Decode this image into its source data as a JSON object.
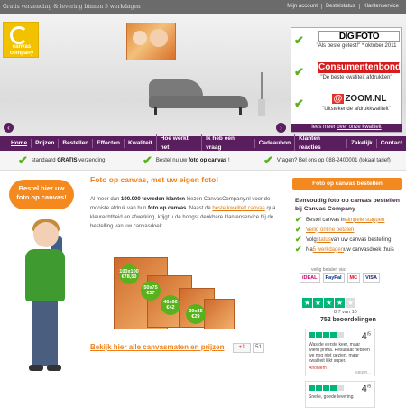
{
  "topbar": {
    "shipping": "Gratis verzending & levering binnen 5 werkdagen",
    "links": [
      "Mijn account",
      "Bestelstatus",
      "Klantenservice"
    ]
  },
  "logo": {
    "line1": "canvas",
    "line2": "company"
  },
  "hero": {
    "prev": "‹",
    "next": "›"
  },
  "reviews": [
    {
      "brand": "DIGIFOTO",
      "quote": "\"Als beste getest!\" * oktober 2011"
    },
    {
      "brand": "Consumentenbond",
      "quote": "\"De beste kwaliteit afdrukken\""
    },
    {
      "brand_prefix": "@",
      "brand": "ZOOM.NL",
      "quote": "\"Uitstekende afdrukkwaliteit\""
    }
  ],
  "lees": {
    "prefix": "lees meer",
    "link": "over onze kwaliteit"
  },
  "nav": [
    "Home",
    "Prijzen",
    "Bestellen",
    "Effecten",
    "Kwaliteit",
    "Hoe werkt het",
    "Ik heb een vraag",
    "Cadeaubon",
    "Klanten reacties",
    "Zakelijk",
    "Contact"
  ],
  "usps": [
    {
      "pre": "standaard ",
      "bold": "GRATIS",
      "post": " verzending"
    },
    {
      "pre": "Bestel nu uw ",
      "bold": "foto op canvas",
      "post": " !"
    },
    {
      "pre": "Vragen? Bel ons op 088-2400001 (lokaal tarief)",
      "bold": "",
      "post": ""
    }
  ],
  "badge": {
    "line1": "Bestel hier uw",
    "line2": "foto op canvas!"
  },
  "main": {
    "title": "Foto op canvas, met uw eigen foto!",
    "p1a": "Al meer dan ",
    "p1b": "100.000 tevreden klanten",
    "p1c": " kiezen CanvasCompany.nl voor de mooiste afdruk van hun ",
    "p1d": "foto op canvas",
    "p1e": ". Naast de ",
    "p1f": "beste kwaliteit canvas",
    "p1g": " qua kleurechtheid en afwerking, krijgt u de hoogst denkbare klantenservice bij de bestelling van uw canvasdoek.",
    "prices": [
      "100x100 €78,50",
      "50x75 €57",
      "40x60 €42",
      "30x45 €29"
    ],
    "allsizes": "Bekijk hier alle canvasmaten en prijzen",
    "gplus": "+1",
    "gcount": "51"
  },
  "right": {
    "button": "Foto op canvas bestellen",
    "heading": "Eenvoudig foto op canvas bestellen bij Canvas Company",
    "steps": [
      {
        "pre": "Bestel canvas in ",
        "link": "simpele stappen",
        "post": ""
      },
      {
        "pre": "",
        "link": "Veilig online betalen",
        "post": ""
      },
      {
        "pre": "Volg ",
        "link": "status",
        "post": " van uw canvas bestelling"
      },
      {
        "pre": "Na ",
        "link": "5 werkdagen",
        "post": " uw canvasdoek thuis"
      }
    ],
    "pay_label": "veilig betalen via:",
    "pay": [
      "iDEAL",
      "PayPal",
      "MC",
      "VISA"
    ],
    "score": "8.7 van 10",
    "review_count": "752 beoordelingen",
    "review1": {
      "score": "4",
      "of": "/5",
      "text": "Was de eerste keer, maar wierd prima. Resultaat hebben we nog niet gezien, maar kwaliteit lijkt super.",
      "author": "Anoniem",
      "more": "MEER..."
    },
    "review2": {
      "score": "4",
      "of": "/5",
      "text": "Snelle, goede levering"
    }
  },
  "colors": {
    "brand": "#5a1e5e",
    "accent": "#f3891f",
    "check": "#5ab11e"
  }
}
